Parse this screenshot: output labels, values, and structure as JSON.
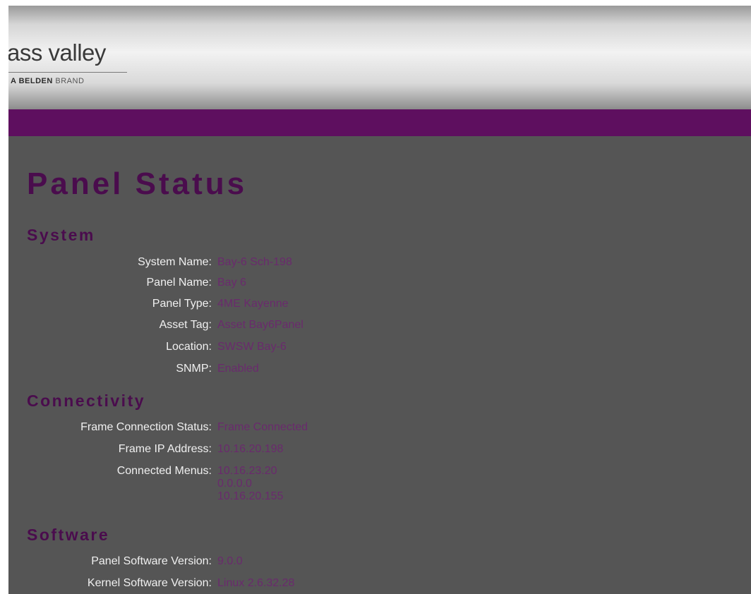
{
  "header": {
    "logo_text": "ass valley",
    "logo_brand_bold": "A BELDEN",
    "logo_brand_light": "BRAND"
  },
  "page_title": "Panel Status",
  "system": {
    "title": "System",
    "rows": [
      {
        "label": "System Name:",
        "value": "Bay-6 Sch-198"
      },
      {
        "label": "Panel Name:",
        "value": "Bay 6"
      },
      {
        "label": "Panel Type:",
        "value": "4ME Kayenne"
      },
      {
        "label": "Asset Tag:",
        "value": "Asset Bay6Panel"
      },
      {
        "label": "Location:",
        "value": "SWSW Bay-6"
      },
      {
        "label": "SNMP:",
        "value": "Enabled"
      }
    ]
  },
  "connectivity": {
    "title": "Connectivity",
    "rows": [
      {
        "label": "Frame Connection Status:",
        "value": "Frame Connected"
      },
      {
        "label": "Frame IP Address:",
        "value": "10.16.20.198"
      },
      {
        "label": "Connected Menus:"
      }
    ],
    "connected_menus": [
      "10.16.23.20",
      "0.0.0.0",
      "10.16.20.155"
    ]
  },
  "software": {
    "title": "Software",
    "rows": [
      {
        "label": "Panel Software Version:",
        "value": "9.0.0"
      },
      {
        "label": "Kernel Software Version:",
        "value": "Linux 2.6.32.28"
      }
    ]
  },
  "colors": {
    "accent_band": "#5e0f5f",
    "heading": "#4a0c4d",
    "value_text": "#6a2a6d",
    "background": "#555555"
  }
}
